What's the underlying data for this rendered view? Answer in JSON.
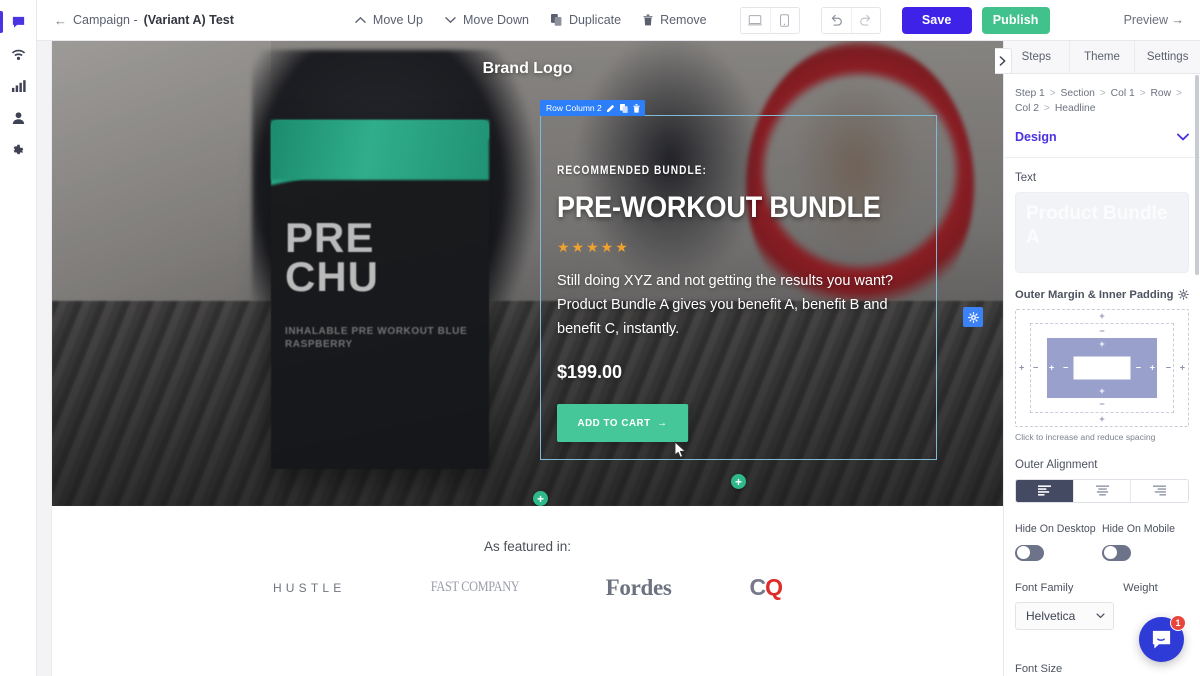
{
  "rail": {
    "items": [
      {
        "name": "chat-icon",
        "active": true
      },
      {
        "name": "wifi-icon",
        "active": false
      },
      {
        "name": "analytics-icon",
        "active": false
      },
      {
        "name": "contacts-icon",
        "active": false
      },
      {
        "name": "settings-icon",
        "active": false
      }
    ]
  },
  "topbar": {
    "back_arrow": "←",
    "campaign_label": "Campaign - ",
    "variant_label": "(Variant A) Test",
    "actions": [
      {
        "label": "Move Up",
        "icon": "chevron-up-icon"
      },
      {
        "label": "Move Down",
        "icon": "chevron-down-icon"
      },
      {
        "label": "Duplicate",
        "icon": "duplicate-icon"
      },
      {
        "label": "Remove",
        "icon": "trash-icon"
      }
    ],
    "device_desktop": "desktop-icon",
    "device_mobile": "mobile-icon",
    "undo": "undo-icon",
    "redo": "redo-icon",
    "save_label": "Save",
    "publish_label": "Publish",
    "preview_label": "Preview →",
    "save_color": "#3e22e8",
    "publish_color": "#41c18c"
  },
  "canvas": {
    "brand_logo": "Brand Logo",
    "row_badge": {
      "label": "Row Column 2",
      "edit_icon": "pencil-icon",
      "duplicate_icon": "duplicate-icon",
      "delete_icon": "trash-icon"
    },
    "hero": {
      "kicker": "RECOMMENDED BUNDLE:",
      "headline": "PRE-WORKOUT BUNDLE",
      "stars": "★★★★★",
      "star_color": "#f0a22e",
      "body": "Still doing XYZ and not getting the results you want? Product Bundle A gives you benefit A, benefit B and benefit C, instantly.",
      "price": "$199.00",
      "cta_label": "ADD TO CART",
      "cta_arrow": "→",
      "cta_color": "#46c79a",
      "bag_text": "PRE CHU",
      "bag_sub": "INHALABLE PRE WORKOUT BLUE RASPBERRY"
    },
    "add_plus": "+",
    "featured": {
      "title": "As featured in:",
      "logos": [
        {
          "name": "hustle",
          "text": "HUSTLE"
        },
        {
          "name": "fast-company",
          "text": "FAST COMPANY"
        },
        {
          "name": "forbes",
          "text": "Fordes"
        },
        {
          "name": "cq",
          "text_c": "C",
          "text_q": "Q"
        }
      ]
    },
    "collapse_icon": "chevron-right-icon"
  },
  "panel": {
    "tabs": [
      {
        "label": "Steps",
        "active": false
      },
      {
        "label": "Theme",
        "active": false
      },
      {
        "label": "Settings",
        "active": false
      }
    ],
    "breadcrumb": [
      "Step 1",
      "Section",
      "Col 1",
      "Row",
      "Col 2",
      "Headline"
    ],
    "breadcrumb_separator": ">",
    "design_label": "Design",
    "design_chevron": "chevron-down-icon",
    "text_label": "Text",
    "text_value": "Product Bundle A",
    "spacing": {
      "title": "Outer Margin & Inner Padding",
      "gear_icon": "gear-icon",
      "hint": "Click to increase and reduce spacing",
      "plus": "+",
      "minus": "−"
    },
    "alignment": {
      "label": "Outer Alignment",
      "options": [
        {
          "name": "align-left",
          "active": true
        },
        {
          "name": "align-center",
          "active": false
        },
        {
          "name": "align-right",
          "active": false
        }
      ]
    },
    "hide_desktop_label": "Hide On Desktop",
    "hide_mobile_label": "Hide On Mobile",
    "hide_desktop_on": false,
    "hide_mobile_on": false,
    "font_family_label": "Font Family",
    "font_family_value": "Helvetica",
    "weight_label": "Weight",
    "font_size_label": "Font Size"
  },
  "intercom": {
    "icon": "chat-icon",
    "badge": "1"
  }
}
